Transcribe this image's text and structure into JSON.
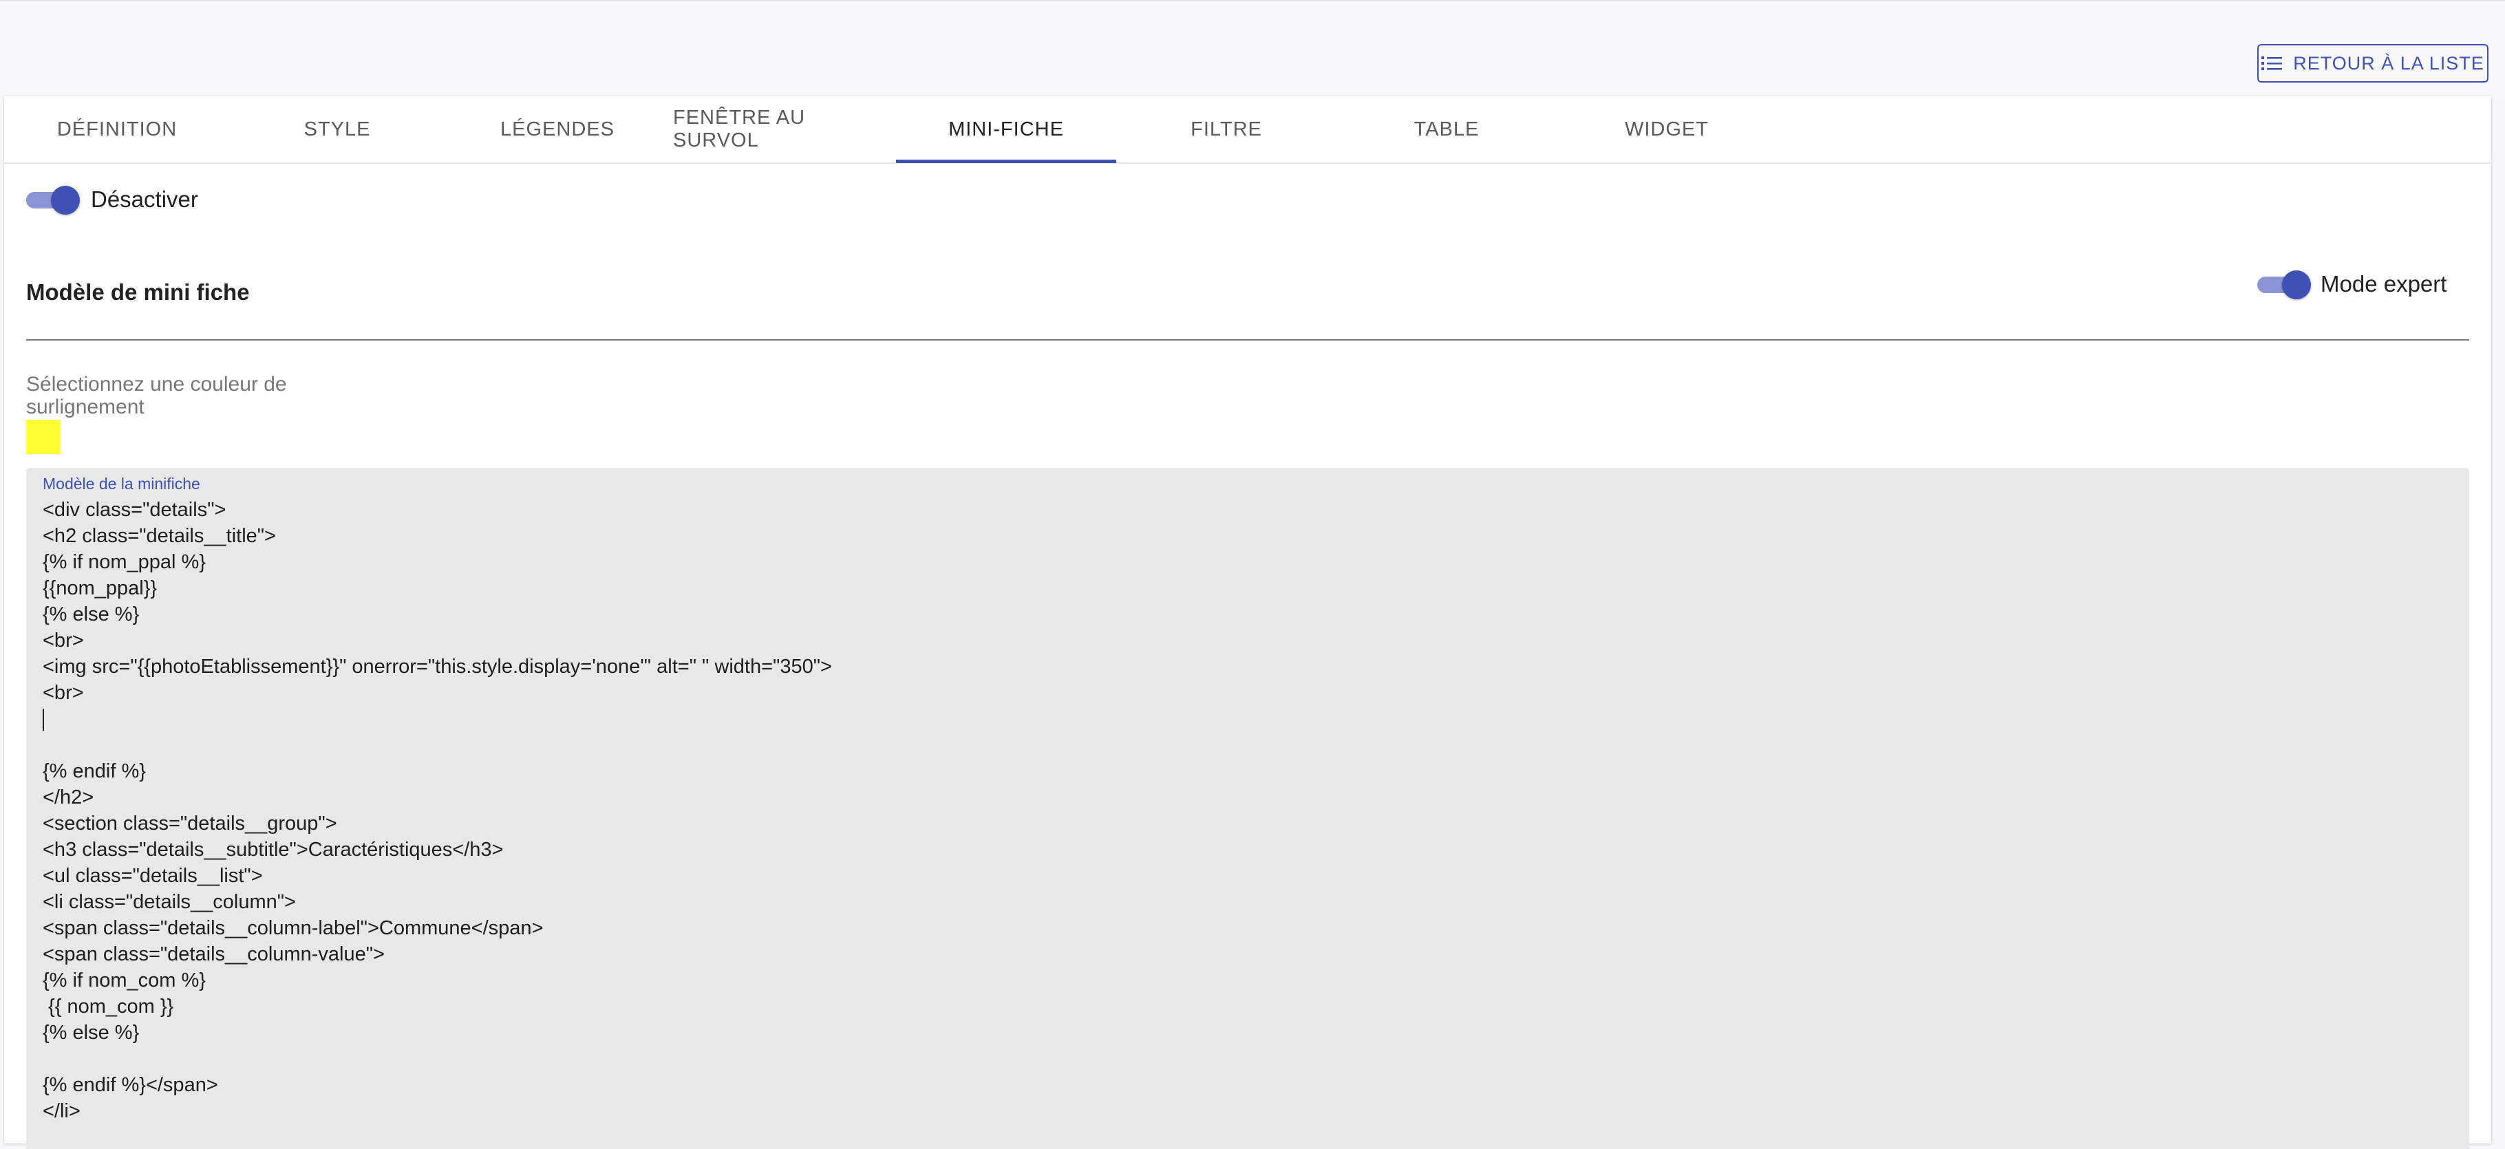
{
  "header": {
    "back_label": "RETOUR À LA LISTE",
    "back_icon": "list-icon"
  },
  "tabs": [
    {
      "label": "DÉFINITION",
      "active": false
    },
    {
      "label": "STYLE",
      "active": false
    },
    {
      "label": "LÉGENDES",
      "active": false
    },
    {
      "label": "FENÊTRE AU SURVOL",
      "active": false
    },
    {
      "label": "MINI-FICHE",
      "active": true
    },
    {
      "label": "FILTRE",
      "active": false
    },
    {
      "label": "TABLE",
      "active": false
    },
    {
      "label": "WIDGET",
      "active": false
    }
  ],
  "disable_toggle": {
    "label": "Désactiver",
    "checked": true
  },
  "section": {
    "title": "Modèle de mini fiche"
  },
  "expert_toggle": {
    "label": "Mode expert",
    "checked": true
  },
  "highlight": {
    "label": "Sélectionnez une couleur de surlignement",
    "color": "#ffff33"
  },
  "editor": {
    "label": "Modèle de la minifiche",
    "lines": [
      "<div class=\"details\">",
      "<h2 class=\"details__title\">",
      "{% if nom_ppal %}",
      "{{nom_ppal}}",
      "{% else %}",
      "<br>",
      "<img src=\"{{photoEtablissement}}\" onerror=\"this.style.display='none'\" alt=\" \" width=\"350\">",
      "<br>",
      "",
      "",
      "{% endif %}",
      "</h2>",
      "<section class=\"details__group\">",
      "<h3 class=\"details__subtitle\">Caractéristiques</h3>",
      "<ul class=\"details__list\">",
      "<li class=\"details__column\">",
      "<span class=\"details__column-label\">Commune</span>",
      "<span class=\"details__column-value\">",
      "{% if nom_com %}",
      " {{ nom_com }}",
      "{% else %}",
      "",
      "{% endif %}</span>",
      "</li>"
    ]
  },
  "colors": {
    "primary": "#3f51b5",
    "primary_light": "#8c96d6"
  }
}
